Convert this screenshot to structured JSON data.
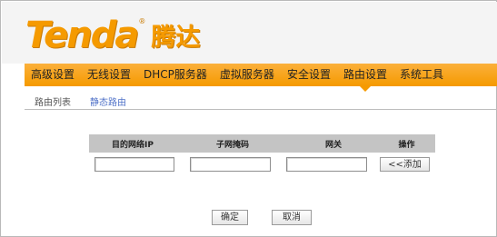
{
  "brand": {
    "logo_text": "Tenda",
    "logo_cn": "腾达",
    "registered_mark": "®"
  },
  "nav": {
    "items": [
      {
        "label": "高级设置"
      },
      {
        "label": "无线设置"
      },
      {
        "label": "DHCP服务器"
      },
      {
        "label": "虚拟服务器"
      },
      {
        "label": "安全设置"
      },
      {
        "label": "路由设置",
        "active": true
      },
      {
        "label": "系统工具"
      }
    ],
    "background": "#f59a00"
  },
  "subnav": {
    "items": [
      {
        "label": "路由列表"
      },
      {
        "label": "静态路由",
        "active": true
      }
    ]
  },
  "route_table": {
    "headers": [
      "目的网络IP",
      "子网掩码",
      "网关",
      "操作"
    ],
    "row": {
      "dest_ip": "",
      "subnet_mask": "",
      "gateway": "",
      "add_label": "<<添加"
    }
  },
  "actions": {
    "confirm_label": "确定",
    "cancel_label": "取消"
  }
}
